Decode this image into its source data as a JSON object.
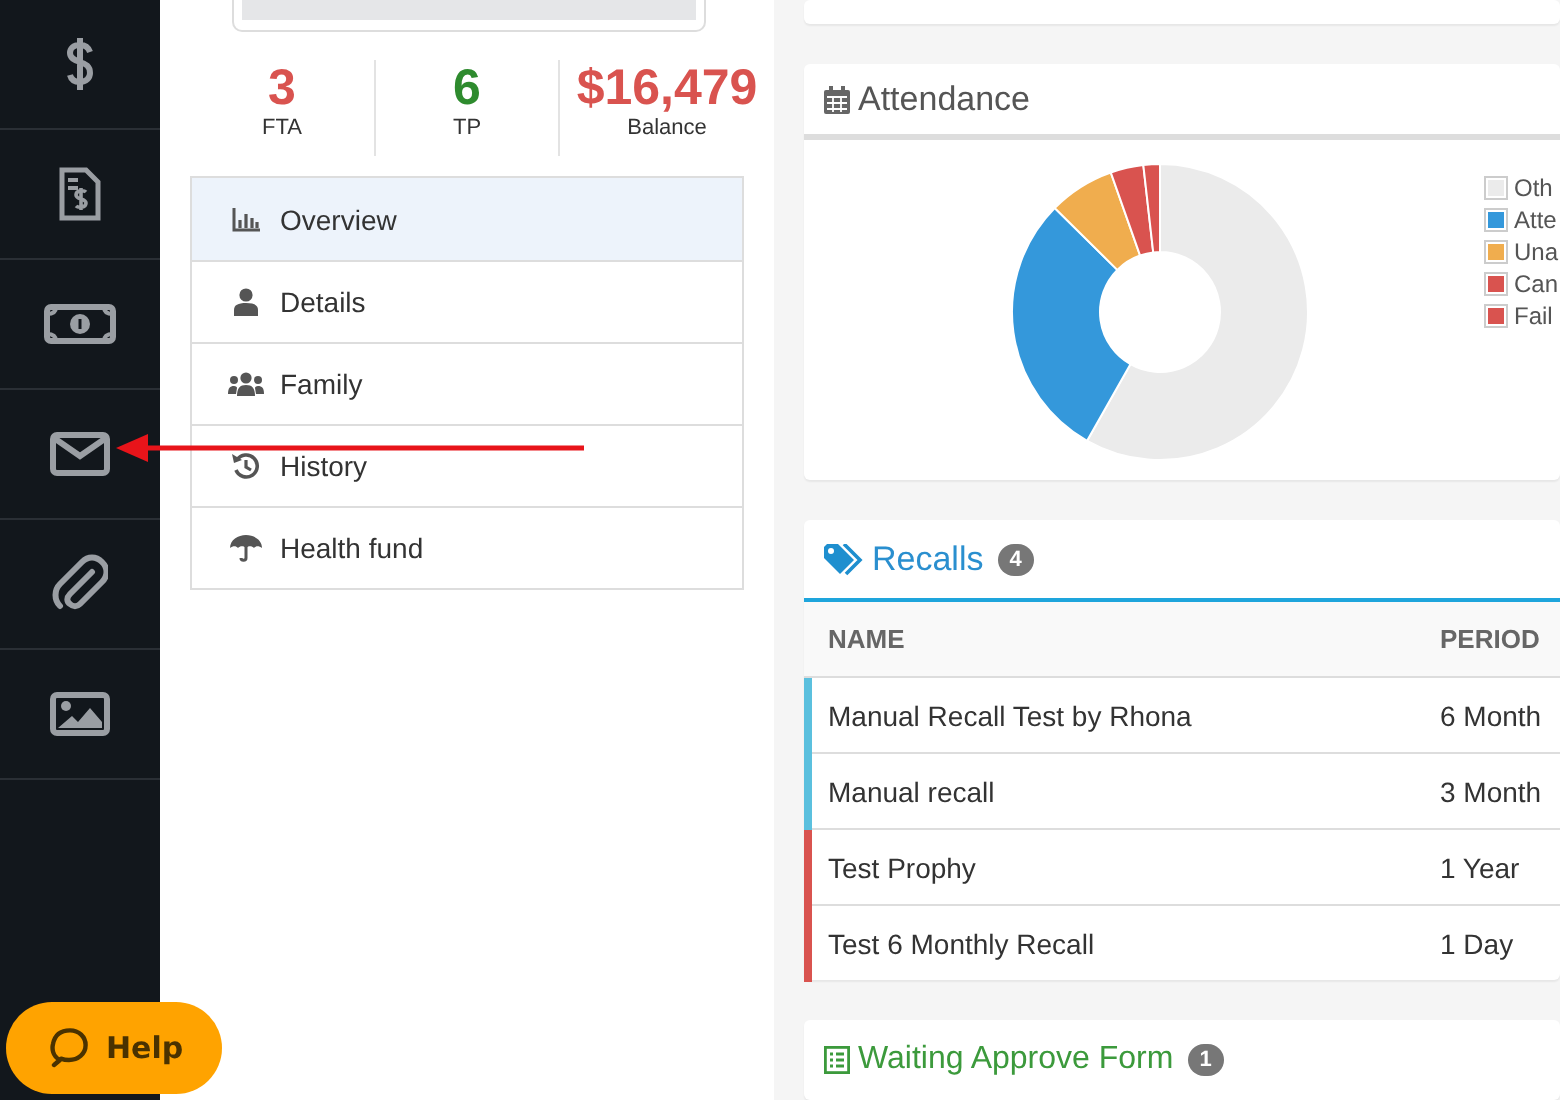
{
  "sidebar": {
    "items": [
      {
        "kind": "dollar"
      },
      {
        "kind": "invoice"
      },
      {
        "kind": "banknote"
      },
      {
        "kind": "envelope"
      },
      {
        "kind": "paperclip"
      },
      {
        "kind": "image"
      }
    ]
  },
  "profile": {
    "stats": [
      {
        "value": "3",
        "label": "FTA",
        "color": "#d9534f"
      },
      {
        "value": "6",
        "label": "TP",
        "color": "#2e8b2e"
      },
      {
        "value": "$16,479",
        "label": "Balance",
        "color": "#d9534f"
      }
    ]
  },
  "menu": [
    {
      "label": "Overview",
      "kind": "chart",
      "selected": true
    },
    {
      "label": "Details",
      "kind": "person",
      "selected": false
    },
    {
      "label": "Family",
      "kind": "people",
      "selected": false
    },
    {
      "label": "History",
      "kind": "history",
      "selected": false
    },
    {
      "label": "Health fund",
      "kind": "umbrella",
      "selected": false
    }
  ],
  "attendance": {
    "title": "Attendance",
    "legend": [
      {
        "label": "Oth",
        "color": "#ebebeb"
      },
      {
        "label": "Atte",
        "color": "#3498db"
      },
      {
        "label": "Una",
        "color": "#f0ad4e"
      },
      {
        "label": "Can",
        "color": "#d9534f"
      },
      {
        "label": "Fail",
        "color": "#d9534f"
      }
    ]
  },
  "recalls": {
    "title": "Recalls",
    "count": "4",
    "columns": [
      "NAME",
      "PERIOD"
    ],
    "rows": [
      {
        "name": "Manual Recall Test by Rhona",
        "period": "6 Month",
        "color": "#5bc0de"
      },
      {
        "name": "Manual recall",
        "period": "3 Month",
        "color": "#5bc0de"
      },
      {
        "name": "Test Prophy",
        "period": "1 Year",
        "color": "#d9534f"
      },
      {
        "name": "Test 6 Monthly Recall",
        "period": "1 Day",
        "color": "#d9534f"
      }
    ]
  },
  "waiting_form": {
    "title": "Waiting Approve Form",
    "count": "1"
  },
  "help_button": {
    "label": "Help"
  }
}
